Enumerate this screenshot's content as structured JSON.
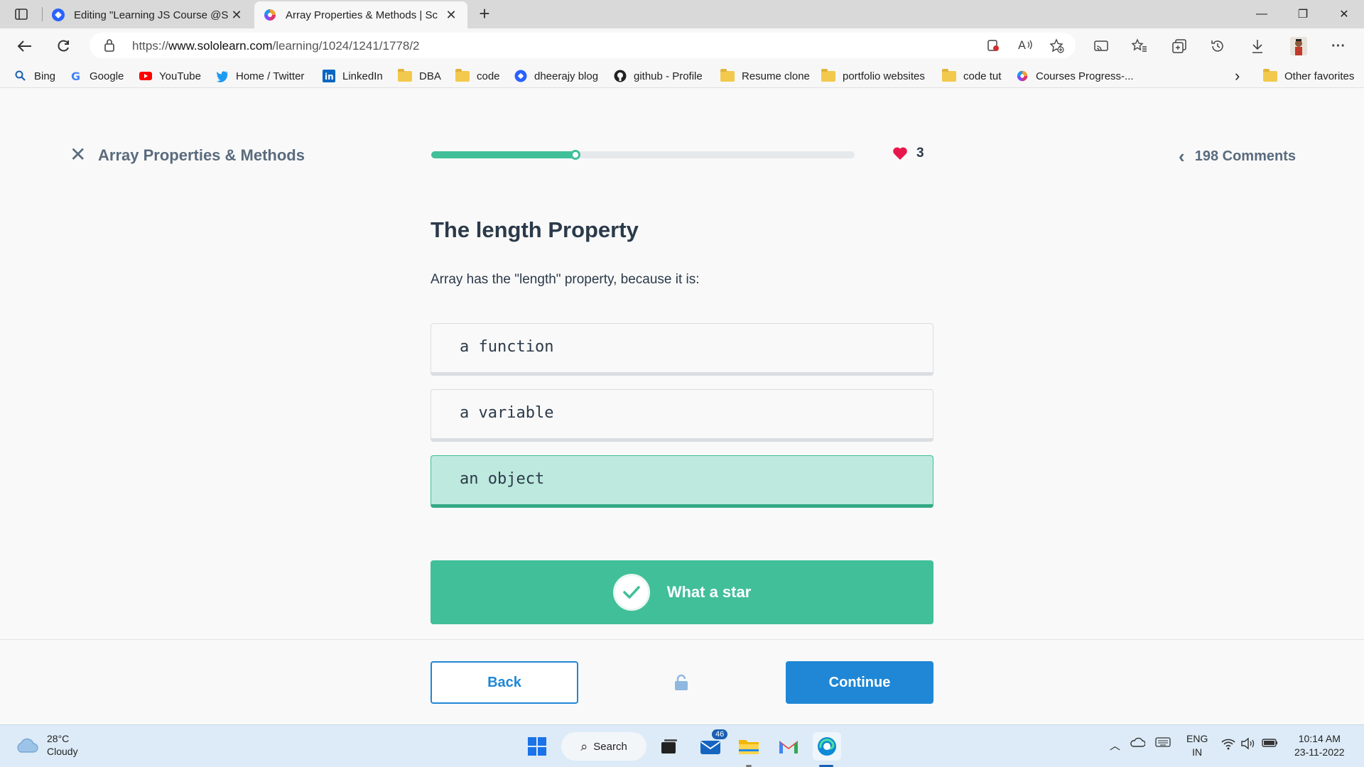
{
  "browser": {
    "tabs": [
      {
        "title": "Editing \"Learning JS Course @Sc",
        "close": "✕"
      },
      {
        "title": "Array Properties & Methods | Sc",
        "close": "✕"
      }
    ],
    "new_tab": "+",
    "window_controls": {
      "minimize": "—",
      "restore": "❐",
      "close": "✕"
    },
    "url_prefix": "https://",
    "url_host": "www.sololearn.com",
    "url_path": "/learning/1024/1241/1778/2"
  },
  "bookmarks": {
    "items": [
      {
        "label": "Bing",
        "icon": "search-icon"
      },
      {
        "label": "Google",
        "icon": "google-icon"
      },
      {
        "label": "YouTube",
        "icon": "youtube-icon"
      },
      {
        "label": "Home / Twitter",
        "icon": "twitter-icon"
      },
      {
        "label": "LinkedIn",
        "icon": "linkedin-icon"
      },
      {
        "label": "DBA",
        "icon": "folder-icon"
      },
      {
        "label": "code",
        "icon": "folder-icon"
      },
      {
        "label": "dheerajy blog",
        "icon": "blog-icon"
      },
      {
        "label": "github - Profile",
        "icon": "github-icon"
      },
      {
        "label": "Resume clone",
        "icon": "folder-icon"
      },
      {
        "label": "portfolio websites",
        "icon": "folder-icon"
      },
      {
        "label": "code tut",
        "icon": "folder-icon"
      },
      {
        "label": "Courses Progress-...",
        "icon": "sololearn-icon"
      }
    ],
    "overflow": "›",
    "other_favorites": "Other favorites"
  },
  "lesson": {
    "title": "Array Properties & Methods",
    "progress": 0.34,
    "hearts": "3",
    "comments": "198 Comments"
  },
  "question": {
    "heading": "The length Property",
    "text": "Array has the \"length\" property, because it is:",
    "options": [
      {
        "label": "a function",
        "selected": false
      },
      {
        "label": "a variable",
        "selected": false
      },
      {
        "label": "an object",
        "selected": true
      }
    ],
    "feedback": "What a star"
  },
  "footer": {
    "back_label": "Back",
    "continue_label": "Continue"
  },
  "taskbar": {
    "weather_temp": "28°C",
    "weather_desc": "Cloudy",
    "search_label": "Search",
    "mail_badge": "46",
    "lang_line1": "ENG",
    "lang_line2": "IN",
    "time": "10:14 AM",
    "date": "23-11-2022"
  },
  "colors": {
    "accent_green": "#41bf99",
    "accent_blue": "#1f87d5",
    "heart_red": "#e8174b",
    "selected_bg": "#bde9de"
  }
}
